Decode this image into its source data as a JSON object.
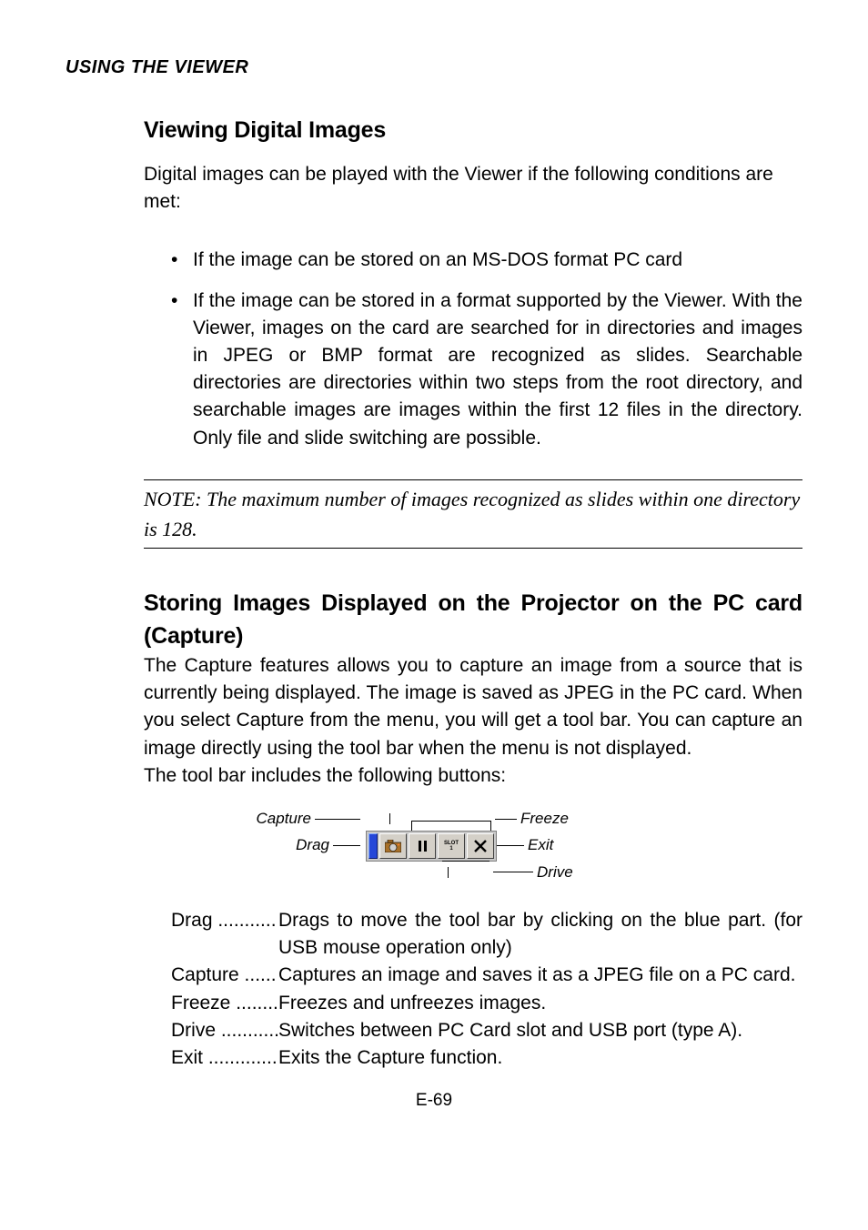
{
  "running_header": "USING THE VIEWER",
  "h1": "Viewing Digital Images",
  "intro": "Digital images can be played with the Viewer if the following conditions are met:",
  "bullets": [
    "If the image can be stored on an MS-DOS format PC card",
    "If the image can be stored in a format supported by the Viewer. With the Viewer, images on the card are searched for in directories and images in JPEG or BMP format are recognized as slides. Searchable directories are directories within two steps from the root directory, and searchable images are images within the first 12 files in the directory. Only file and slide switching are possible."
  ],
  "note": "NOTE: The maximum number of images recognized as slides within one directory is 128.",
  "h2": "Storing Images Displayed on the Projector on the PC card (Capture)",
  "h2body1": "The Capture features allows you to capture an image from a source that is currently being displayed. The image is saved as JPEG in the PC card. When you select Capture from the menu, you will get a tool bar. You can capture an image directly using the tool bar when the menu is not displayed.",
  "h2body2": "The tool bar includes the following buttons:",
  "toolbar_labels": {
    "capture": "Capture",
    "freeze": "Freeze",
    "drag": "Drag",
    "exit": "Exit",
    "drive": "Drive"
  },
  "slot_top": "SLOT",
  "slot_bottom": "1",
  "defs": [
    {
      "term": "Drag ...........",
      "desc": "Drags to move the tool bar by clicking on the blue part. (for USB mouse operation only)",
      "cont": true
    },
    {
      "term": "Capture ......",
      "desc": "Captures an image and saves it as a JPEG file on a PC card.",
      "cont": true
    },
    {
      "term": "Freeze ........",
      "desc": "Freezes and unfreezes images."
    },
    {
      "term": "Drive ...........",
      "desc": "Switches between PC Card slot and USB port (type A)."
    },
    {
      "term": "Exit .............",
      "desc": "Exits the Capture function."
    }
  ],
  "page_number": "E-69"
}
